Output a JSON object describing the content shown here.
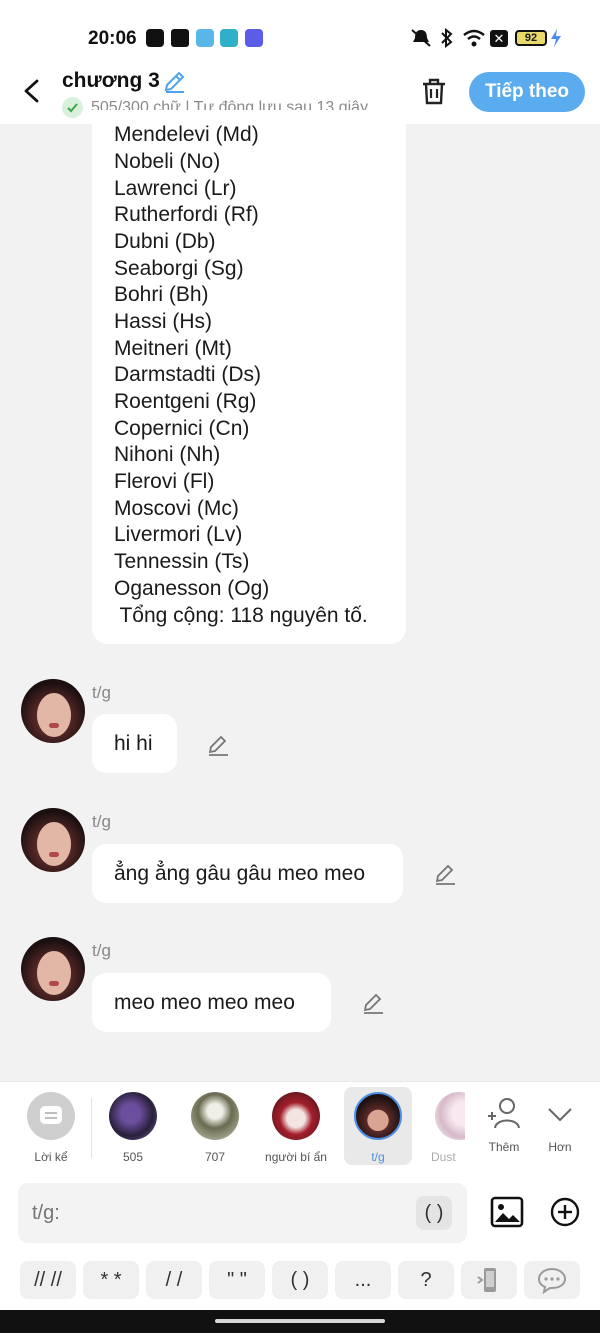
{
  "status_bar": {
    "time": "20:06",
    "battery": "92",
    "apps": [
      "p-app-icon",
      "shop-app-icon",
      "robot-app-icon",
      "bird-app-icon",
      "purple-app-icon"
    ]
  },
  "header": {
    "title": "chương 3",
    "subtitle": "505/300 chữ | Tự động lưu sau 13 giây",
    "next_button": "Tiếp theo",
    "accent": "#5aacee"
  },
  "element_list": [
    "Mendelevi (Md)",
    "Nobeli (No)",
    "Lawrenci (Lr)",
    "Rutherfordi (Rf)",
    "Dubni (Db)",
    "Seaborgi (Sg)",
    "Bohri (Bh)",
    "Hassi (Hs)",
    "Meitneri (Mt)",
    "Darmstadti (Ds)",
    "Roentgeni (Rg)",
    "Copernici (Cn)",
    "Nihoni (Nh)",
    "Flerovi (Fl)",
    "Moscovi (Mc)",
    "Livermori (Lv)",
    "Tennessin (Ts)",
    "Oganesson (Og)"
  ],
  "total_line": " Tổng cộng: 118 nguyên tố.",
  "messages": [
    {
      "sender": "t/g",
      "text": "hi hi"
    },
    {
      "sender": "t/g",
      "text": "ẳng ẳng gâu gâu meo meo"
    },
    {
      "sender": "t/g",
      "text": "meo meo meo meo"
    }
  ],
  "characters": [
    {
      "label": "Lời kể"
    },
    {
      "label": "505"
    },
    {
      "label": "707"
    },
    {
      "label": "người bí ẩn"
    },
    {
      "label": "t/g"
    },
    {
      "label": "Dust"
    },
    {
      "label": "Thêm"
    },
    {
      "label": "Hơn"
    }
  ],
  "composer": {
    "placeholder": "t/g:",
    "paren_button": "( )"
  },
  "toolbar": [
    "// //",
    "* *",
    "/ /",
    "\" \"",
    "( )",
    "...",
    "?"
  ]
}
